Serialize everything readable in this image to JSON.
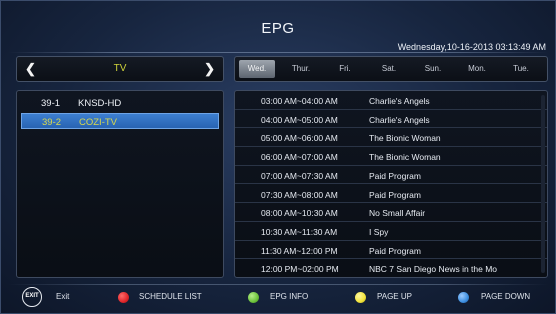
{
  "header": {
    "title": "EPG",
    "datetime": "Wednesday,10-16-2013 03:13:49 AM"
  },
  "category": {
    "label": "TV",
    "prev_icon": "chevron-left-icon",
    "next_icon": "chevron-right-icon"
  },
  "channels": [
    {
      "number": "39-1",
      "name": "KNSD-HD",
      "selected": false
    },
    {
      "number": "39-2",
      "name": "COZI-TV",
      "selected": true
    }
  ],
  "days": [
    "Wed.",
    "Thur.",
    "Fri.",
    "Sat.",
    "Sun.",
    "Mon.",
    "Tue."
  ],
  "selected_day": "Wed.",
  "programs": [
    {
      "time": "03:00 AM~04:00 AM",
      "title": "Charlie's Angels"
    },
    {
      "time": "04:00 AM~05:00 AM",
      "title": "Charlie's Angels"
    },
    {
      "time": "05:00 AM~06:00 AM",
      "title": "The Bionic Woman"
    },
    {
      "time": "06:00 AM~07:00 AM",
      "title": "The Bionic Woman"
    },
    {
      "time": "07:00 AM~07:30 AM",
      "title": "Paid Program"
    },
    {
      "time": "07:30 AM~08:00 AM",
      "title": "Paid Program"
    },
    {
      "time": "08:00 AM~10:30 AM",
      "title": "No Small Affair"
    },
    {
      "time": "10:30 AM~11:30 AM",
      "title": "I Spy"
    },
    {
      "time": "11:30 AM~12:00 PM",
      "title": "Paid Program"
    },
    {
      "time": "12:00 PM~02:00 PM",
      "title": "NBC 7 San Diego News in the Mo"
    }
  ],
  "legend": {
    "exit_badge": "EXIT",
    "exit_label": "Exit",
    "red_label": "SCHEDULE LIST",
    "green_label": "EPG INFO",
    "yellow_label": "PAGE UP",
    "blue_label": "PAGE DOWN"
  },
  "colors": {
    "red": "#e0262a",
    "green": "#6cc23b",
    "yellow": "#f2e33a",
    "blue": "#3d8fe0",
    "highlight": "#3372c4",
    "category_text": "#cfd33a"
  }
}
